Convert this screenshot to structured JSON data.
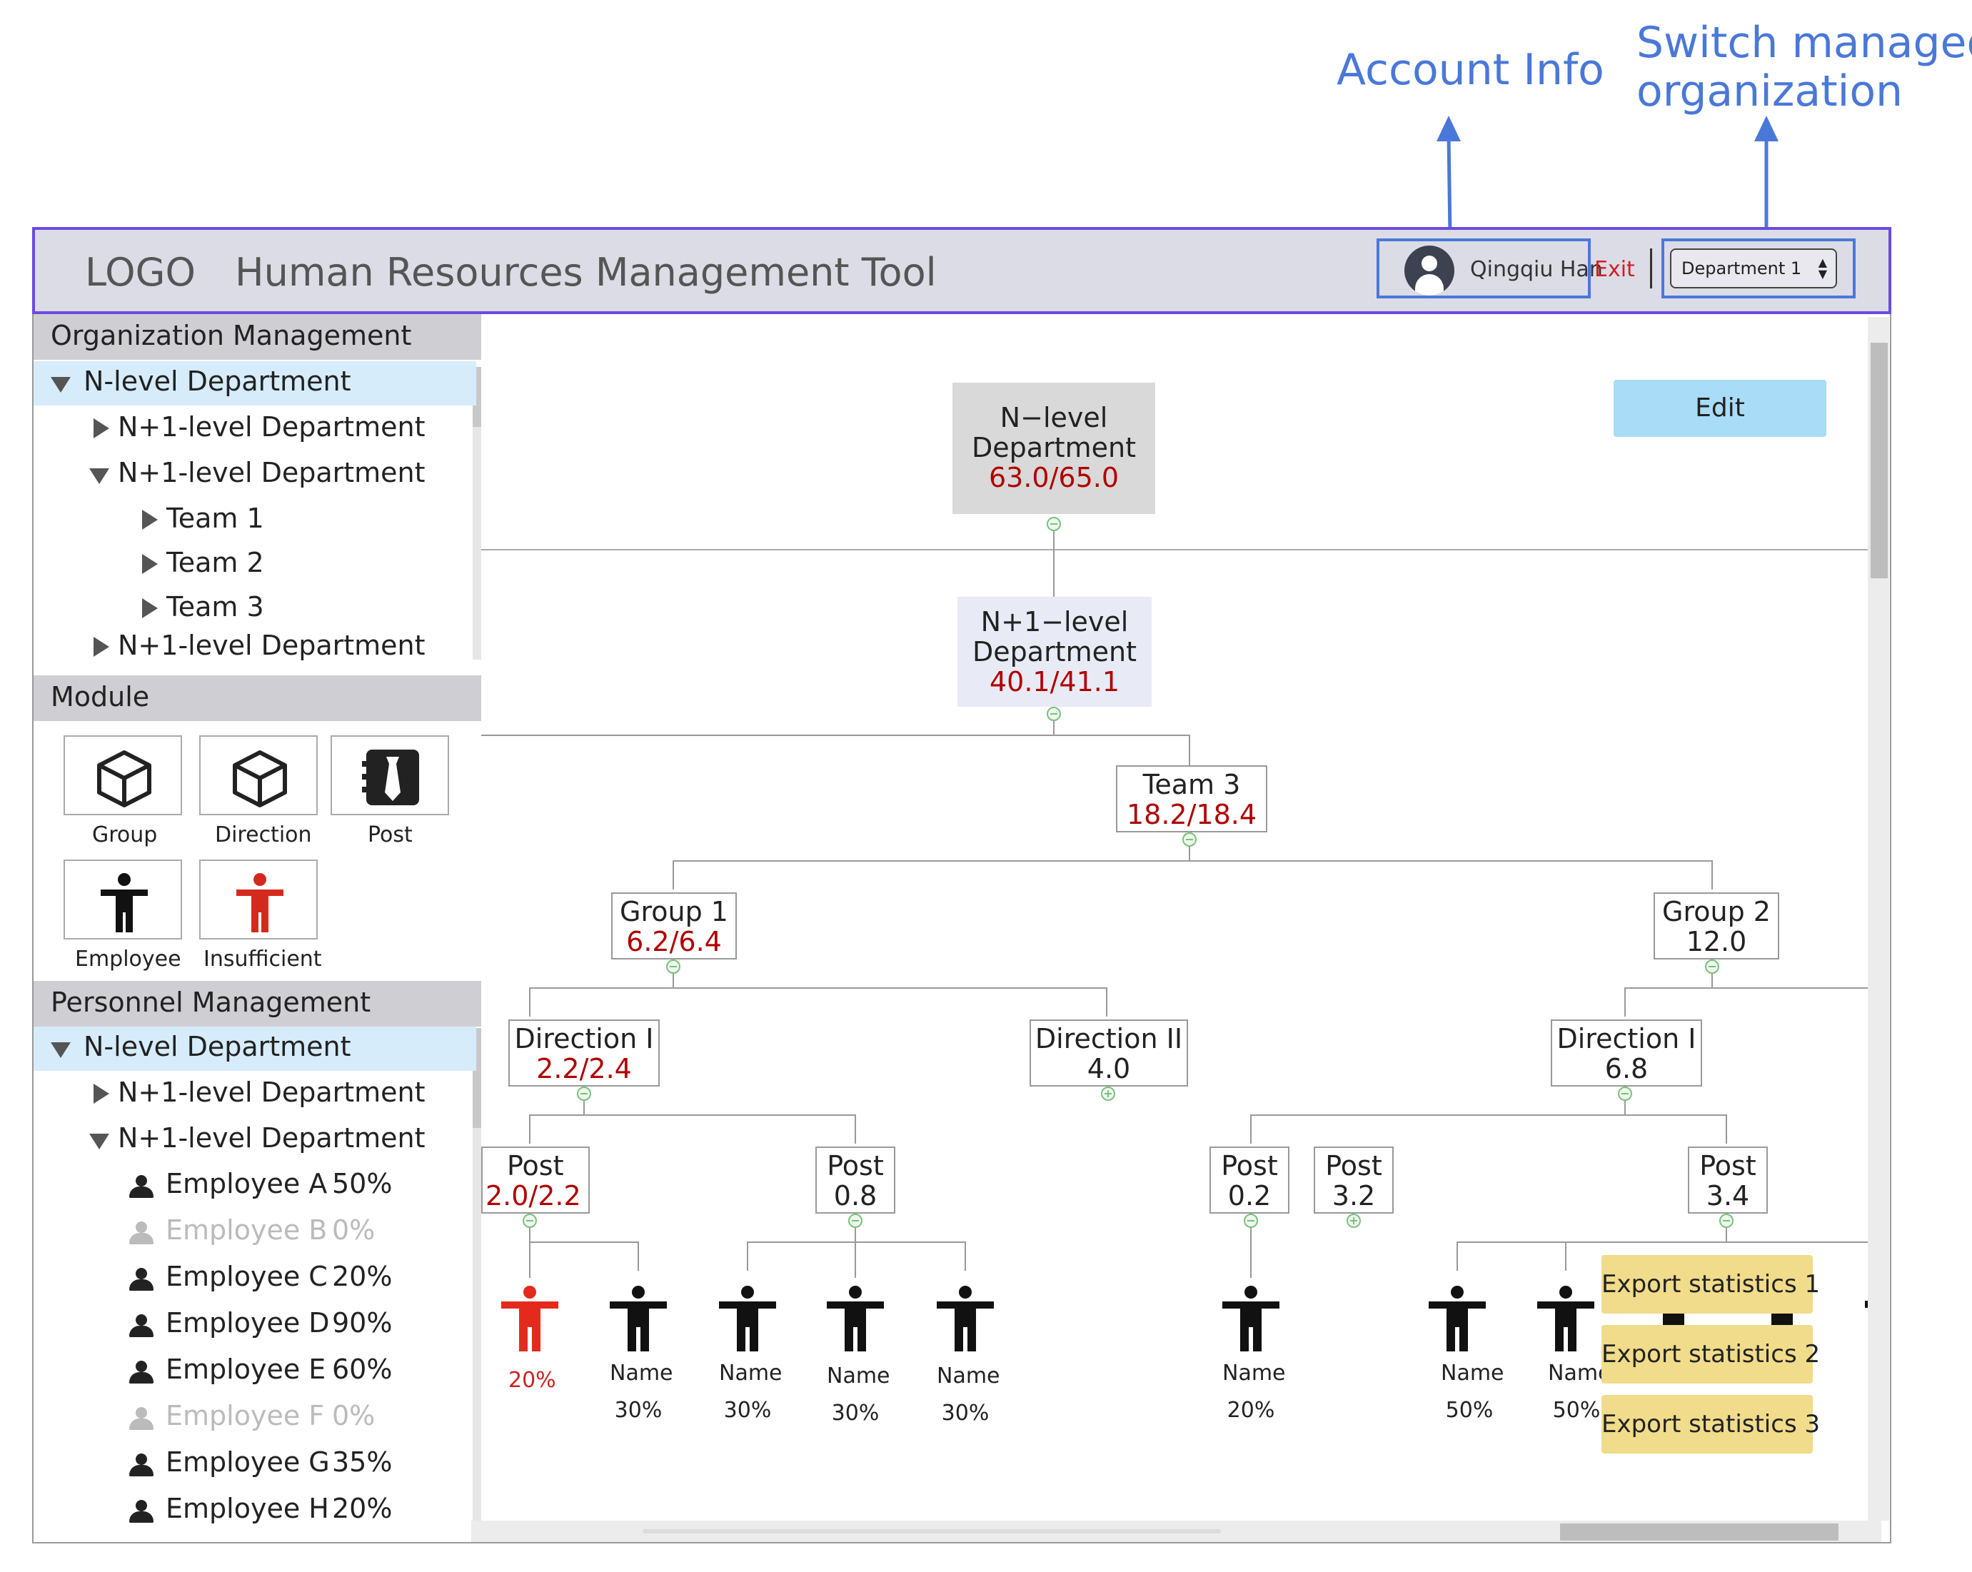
{
  "annotations": {
    "account_info": "Account Info",
    "switch_org_line1": "Switch managed",
    "switch_org_line2": "organization"
  },
  "header": {
    "logo": "LOGO",
    "title": "Human Resources Management Tool",
    "user_name": "Qingqiu Han",
    "exit_label": "Exit",
    "org_select_value": "Department 1"
  },
  "sidebar": {
    "org_section": {
      "title": "Organization Management",
      "tree": [
        {
          "label": "N-level Department",
          "expanded": true,
          "selected": true
        },
        {
          "label": "N+1-level Department",
          "expanded": false
        },
        {
          "label": "N+1-level Department",
          "expanded": true
        },
        {
          "label": "Team 1",
          "expanded": false
        },
        {
          "label": "Team 2",
          "expanded": false
        },
        {
          "label": "Team 3",
          "expanded": false
        },
        {
          "label": "N+1-level Department",
          "expanded": false
        }
      ]
    },
    "module_section": {
      "title": "Module",
      "items": [
        {
          "label": "Group",
          "icon": "cube-icon"
        },
        {
          "label": "Direction",
          "icon": "cube-icon"
        },
        {
          "label": "Post",
          "icon": "post-icon"
        },
        {
          "label": "Employee",
          "icon": "person-figure-icon"
        },
        {
          "label": "Insufficient",
          "icon": "person-figure-red-icon"
        }
      ]
    },
    "personnel_section": {
      "title": "Personnel Management",
      "tree": [
        {
          "label": "N-level Department",
          "expanded": true,
          "selected": true
        },
        {
          "label": "N+1-level Department",
          "expanded": false
        },
        {
          "label": "N+1-level Department",
          "expanded": true
        }
      ],
      "employees": [
        {
          "name": "Employee A",
          "percent": "50%",
          "muted": false
        },
        {
          "name": "Employee B",
          "percent": "0%",
          "muted": true
        },
        {
          "name": "Employee C",
          "percent": "20%",
          "muted": false
        },
        {
          "name": "Employee D",
          "percent": "90%",
          "muted": false
        },
        {
          "name": "Employee E",
          "percent": "60%",
          "muted": false
        },
        {
          "name": "Employee F",
          "percent": "0%",
          "muted": true
        },
        {
          "name": "Employee G",
          "percent": "35%",
          "muted": false
        },
        {
          "name": "Employee H",
          "percent": "20%",
          "muted": false
        }
      ]
    }
  },
  "main": {
    "edit_label": "Edit",
    "nodes": {
      "root": {
        "title_line1": "N−level",
        "title_line2": "Department",
        "value": "63.0/65.0"
      },
      "n1": {
        "title_line1": "N+1−level",
        "title_line2": "Department",
        "value": "40.1/41.1"
      },
      "team3": {
        "title": "Team 3",
        "value": "18.2/18.4"
      },
      "group1": {
        "title": "Group 1",
        "value": "6.2/6.4"
      },
      "group2": {
        "title": "Group 2",
        "value": "12.0"
      },
      "dir1_g1": {
        "title": "Direction I",
        "value": "2.2/2.4"
      },
      "dir2_g1": {
        "title": "Direction II",
        "value": "4.0"
      },
      "dir1_g2": {
        "title": "Direction I",
        "value": "6.8"
      },
      "post_a": {
        "title": "Post",
        "value": "2.0/2.2"
      },
      "post_b": {
        "title": "Post",
        "value": "0.8"
      },
      "post_c": {
        "title": "Post",
        "value": "0.2"
      },
      "post_d": {
        "title": "Post",
        "value": "3.2"
      },
      "post_e": {
        "title": "Post",
        "value": "3.4"
      }
    },
    "figures": [
      {
        "name": "",
        "percent": "20%",
        "insufficient": true
      },
      {
        "name": "Name",
        "percent": "30%"
      },
      {
        "name": "Name",
        "percent": "30%"
      },
      {
        "name": "Name",
        "percent": "30%"
      },
      {
        "name": "Name",
        "percent": "30%"
      },
      {
        "name": "Name",
        "percent": "20%"
      },
      {
        "name": "Name",
        "percent": "50%"
      },
      {
        "name": "Name",
        "percent": "50%"
      }
    ],
    "export_buttons": [
      "Export statistics 1",
      "Export statistics 2",
      "Export statistics 3"
    ]
  },
  "colors": {
    "accent_annotation": "#4a78d8",
    "header_border": "#6a4be0",
    "insufficient_red": "#cc2222",
    "value_red": "#b00000",
    "edit_button": "#a9dcf7",
    "export_button": "#f0dc8a",
    "selected_row": "#d6ecfb"
  }
}
